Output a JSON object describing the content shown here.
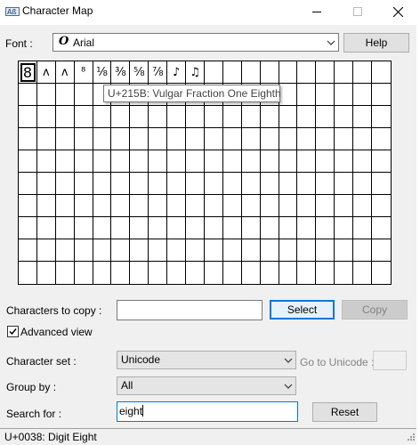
{
  "window": {
    "title": "Character Map"
  },
  "font_row": {
    "label": "Font :",
    "font_glyph": "O",
    "font_value": "Arial",
    "help_label": "Help"
  },
  "grid": {
    "columns": 20,
    "rows": 10,
    "characters": [
      "8",
      "ʌ",
      "ʌ",
      "⁸",
      "⅛",
      "⅜",
      "⅝",
      "⅞",
      "♪",
      "♫"
    ],
    "selected_index": 0
  },
  "tooltip": {
    "text": "U+215B: Vulgar Fraction One Eighth"
  },
  "copy_row": {
    "label": "Characters to copy :",
    "value": "",
    "select_label": "Select",
    "copy_label": "Copy"
  },
  "advanced": {
    "label": "Advanced view",
    "checked": true
  },
  "charset_row": {
    "label": "Character set :",
    "value": "Unicode",
    "goto_label": "Go to Unicode :",
    "goto_value": ""
  },
  "groupby_row": {
    "label": "Group by :",
    "value": "All"
  },
  "search_row": {
    "label": "Search for :",
    "value": "eight",
    "reset_label": "Reset"
  },
  "status": {
    "text": "U+0038: Digit Eight"
  },
  "colors": {
    "accent": "#0078d7",
    "dialog_bg": "#f0f0f0",
    "disabled_text": "#838383"
  }
}
